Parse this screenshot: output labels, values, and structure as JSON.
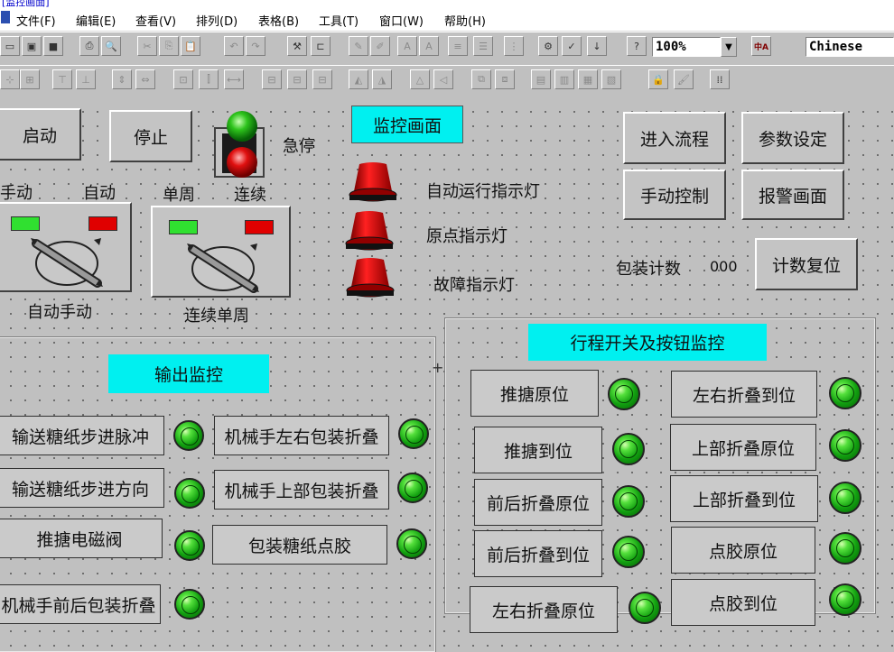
{
  "window": {
    "title": "[监控画面]"
  },
  "menubar": {
    "items": [
      "文件(F)",
      "编辑(E)",
      "查看(V)",
      "排列(D)",
      "表格(B)",
      "工具(T)",
      "窗口(W)",
      "帮助(H)"
    ]
  },
  "toolbar": {
    "zoom": "100%",
    "language": "Chinese",
    "lang_icon_text": "中A"
  },
  "screen": {
    "title": "监控画面",
    "buttons": {
      "start": "启动",
      "stop": "停止",
      "enter_process": "进入流程",
      "params": "参数设定",
      "manual_control": "手动控制",
      "alarm": "报警画面",
      "count_reset": "计数复位"
    },
    "estop_label": "急停",
    "selector_auto_manual": {
      "left": "手动",
      "right": "自动",
      "caption": "自动手动"
    },
    "selector_continuous": {
      "left": "单周",
      "right": "连续",
      "caption": "连续单周"
    },
    "indicators": [
      "自动运行指示灯",
      "原点指示灯",
      "故障指示灯"
    ],
    "counter": {
      "label": "包装计数",
      "value": "000"
    },
    "output_panel": {
      "title": "输出监控",
      "left_items": [
        "输送糖纸步进脉冲",
        "输送糖纸步进方向",
        "推搪电磁阀",
        "机械手前后包装折叠"
      ],
      "right_items": [
        "机械手左右包装折叠",
        "机械手上部包装折叠",
        "包装糖纸点胶"
      ]
    },
    "switch_panel": {
      "title": "行程开关及按钮监控",
      "left_items": [
        "推搪原位",
        "推搪到位",
        "前后折叠原位",
        "前后折叠到位",
        "左右折叠原位"
      ],
      "right_items": [
        "左右折叠到位",
        "上部折叠原位",
        "上部折叠到位",
        "点胶原位",
        "点胶到位"
      ]
    }
  },
  "colors": {
    "cyan": "#00f0f0",
    "led_green": "#12a010",
    "lamp_red": "#e00000",
    "canvas": "#c0c0c0"
  }
}
